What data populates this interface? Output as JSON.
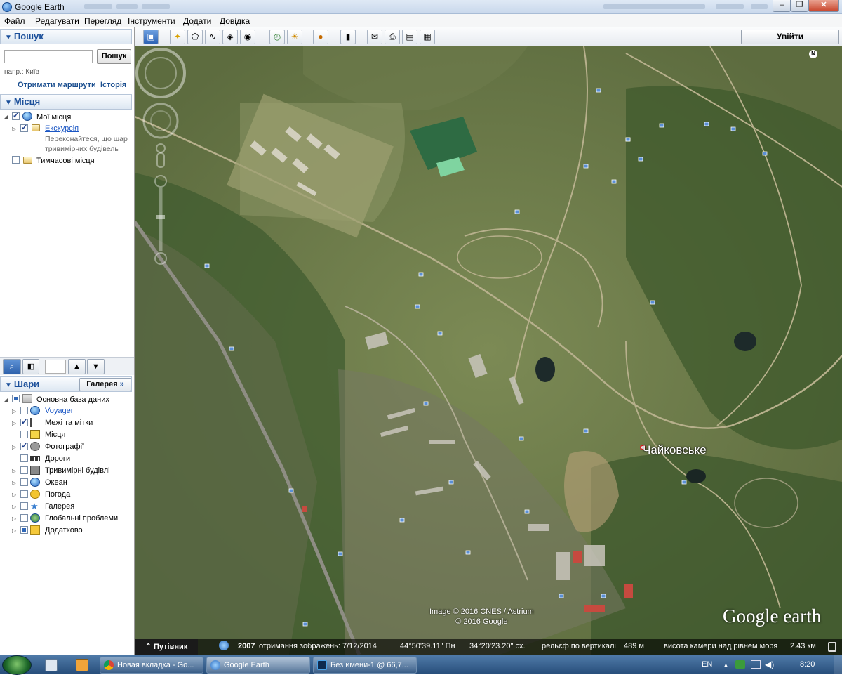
{
  "window": {
    "title": "Google Earth"
  },
  "menu": [
    "Файл",
    "Редагувати",
    "Перегляд",
    "Інструменти",
    "Додати",
    "Довідка"
  ],
  "search": {
    "header": "Пошук",
    "button": "Пошук",
    "hint": "напр.: Київ",
    "directions_link": "Отримати маршрути",
    "history_link": "Історія"
  },
  "places": {
    "header": "Місця",
    "items": [
      {
        "label": "Мої місця"
      },
      {
        "label": "Екскурсія",
        "description": "Переконайтеся, що шар тривимірних будівель"
      },
      {
        "label": "Тимчасові місця"
      }
    ]
  },
  "layers": {
    "header": "Шари",
    "gallery_button": "Галерея",
    "items": [
      {
        "label": "Основна база даних"
      },
      {
        "label": "Voyager"
      },
      {
        "label": "Межі та мітки"
      },
      {
        "label": "Місця"
      },
      {
        "label": "Фотографії"
      },
      {
        "label": "Дороги"
      },
      {
        "label": "Тривимірні будівлі"
      },
      {
        "label": "Океан"
      },
      {
        "label": "Погода"
      },
      {
        "label": "Галерея"
      },
      {
        "label": "Глобальні проблеми"
      },
      {
        "label": "Додатково"
      }
    ]
  },
  "toolbar": {
    "sign_in": "Увійти"
  },
  "map": {
    "place_label": "Чайковське",
    "copyright_1": "Image © 2016 CNES / Astrium",
    "copyright_2": "© 2016 Google",
    "logo": "Google earth",
    "compass_n": "N"
  },
  "status": {
    "tour_guide": "Путівник",
    "imagery_year": "2007",
    "imagery_date": "отримання зображень: 7/12/2014",
    "lat": "44°50'39.11\" Пн",
    "lon": "34°20'23.20\" сх.",
    "elevation_label": "рельєф по вертикалі",
    "elevation_value": "489 м",
    "eye_alt_label": "висота камери над рівнем моря",
    "eye_alt_value": "2.43 км"
  },
  "taskbar": {
    "tasks": [
      {
        "label": "Новая вкладка - Go..."
      },
      {
        "label": "Google Earth"
      },
      {
        "label": "Без имени-1 @ 66,7..."
      }
    ],
    "lang": "EN",
    "time": "8:20"
  },
  "colors": {
    "link": "#1a4e8f",
    "header_text": "#1b4f9a",
    "taskbar": "#274d7a"
  }
}
